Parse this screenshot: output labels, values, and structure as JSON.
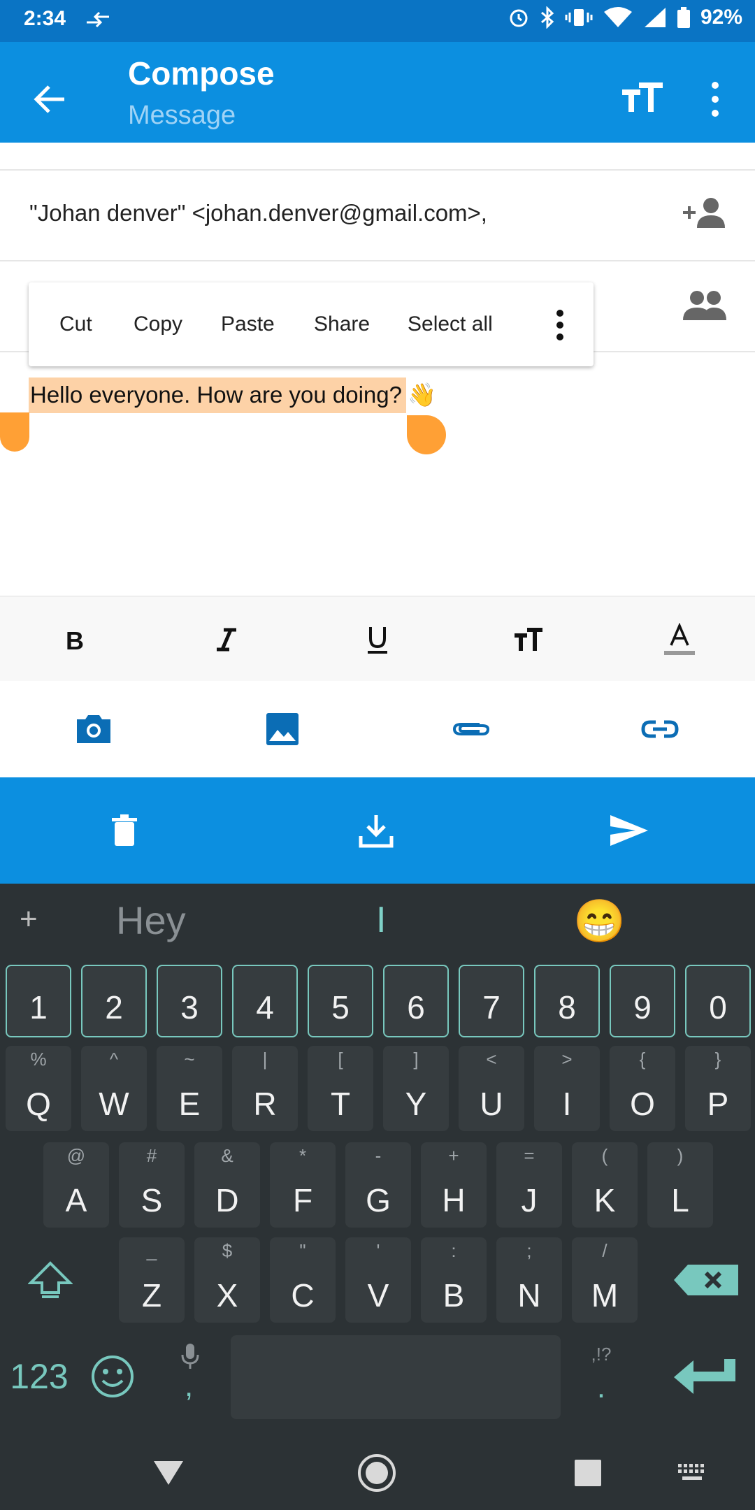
{
  "status_bar": {
    "time": "2:34",
    "battery": "92%"
  },
  "app_bar": {
    "title": "Compose",
    "subtitle": "Message"
  },
  "recipient_field": {
    "value": "\"Johan denver\" <johan.denver@gmail.com>,"
  },
  "context_menu": {
    "items": [
      "Cut",
      "Copy",
      "Paste",
      "Share",
      "Select all"
    ]
  },
  "message_body": {
    "text": "Hello everyone. How are you doing?",
    "emoji": "👋"
  },
  "format_toolbar": {
    "buttons": [
      "bold",
      "italic",
      "underline",
      "text-size",
      "text-color"
    ]
  },
  "attach_bar": {
    "buttons": [
      "camera",
      "gallery",
      "attach-file",
      "insert-link"
    ]
  },
  "action_bar": {
    "buttons": [
      "delete",
      "save-draft",
      "send"
    ]
  },
  "keyboard": {
    "suggestions": [
      "Hey",
      "I",
      "😁"
    ],
    "number_row": [
      "1",
      "2",
      "3",
      "4",
      "5",
      "6",
      "7",
      "8",
      "9",
      "0"
    ],
    "row1": {
      "keys": [
        "Q",
        "W",
        "E",
        "R",
        "T",
        "Y",
        "U",
        "I",
        "O",
        "P"
      ],
      "alts": [
        "%",
        "^",
        "~",
        "|",
        "[",
        "]",
        "<",
        ">",
        "{",
        "}"
      ]
    },
    "row2": {
      "keys": [
        "A",
        "S",
        "D",
        "F",
        "G",
        "H",
        "J",
        "K",
        "L"
      ],
      "alts": [
        "@",
        "#",
        "&",
        "*",
        "-",
        "+",
        "=",
        "(",
        ")"
      ]
    },
    "row3": {
      "keys": [
        "Z",
        "X",
        "C",
        "V",
        "B",
        "N",
        "M"
      ],
      "alts": [
        "_",
        "$",
        "\"",
        "'",
        ":",
        ";",
        "/"
      ]
    },
    "bottom": {
      "symbols_label": "123",
      "comma": ",",
      "period": ".",
      "period_alts": ",!?"
    }
  },
  "colors": {
    "app_bar": "#0c8fe0",
    "status_bar": "#0a74c4",
    "selection": "#fdd2a7",
    "handle": "#ffa035",
    "keyboard_bg": "#2c3235",
    "keyboard_accent": "#78c8be"
  }
}
